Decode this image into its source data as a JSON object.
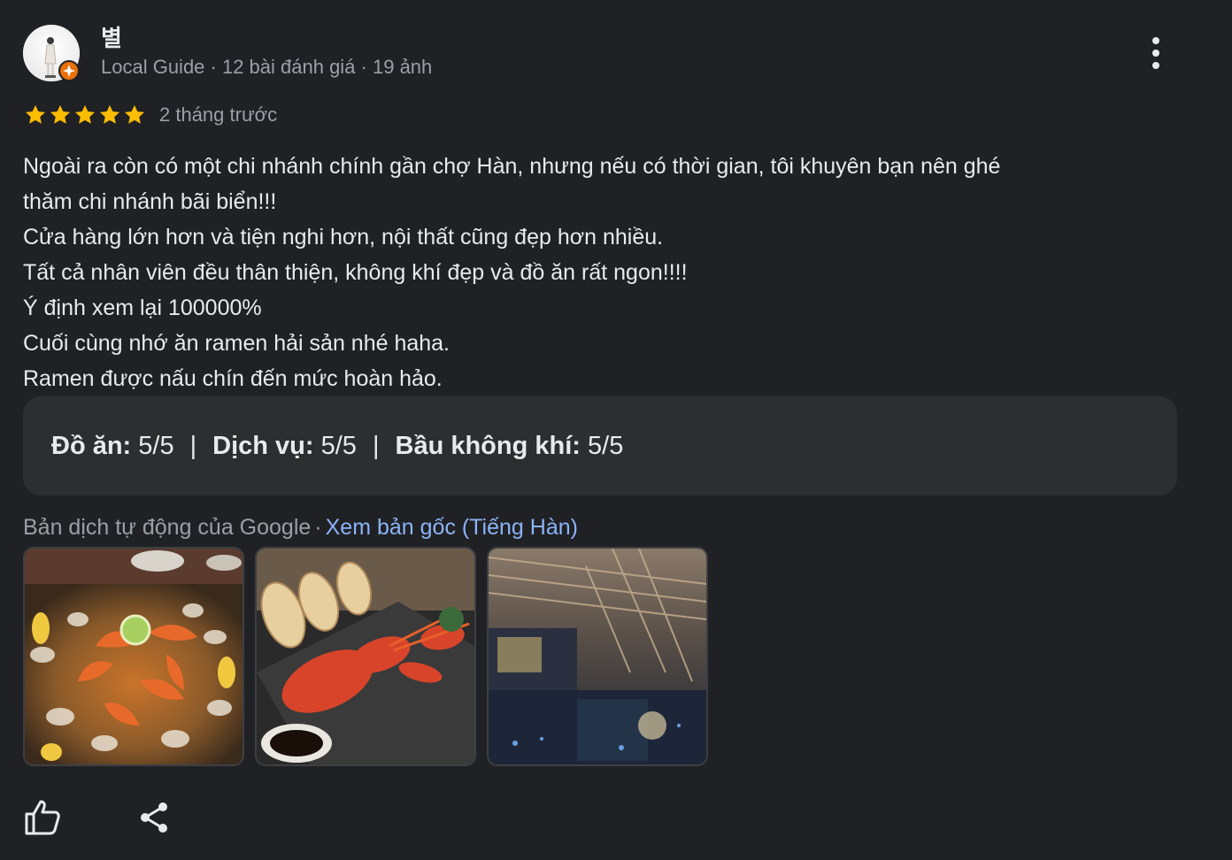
{
  "reviewer": {
    "name": "별",
    "meta": "Local Guide · 12 bài đánh giá · 19 ảnh"
  },
  "review": {
    "stars": 5,
    "time": "2 tháng trước",
    "lines": [
      "Ngoài ra còn có một chi nhánh chính gần chợ Hàn, nhưng nếu có thời gian, tôi khuyên bạn nên ghé",
      "thăm chi nhánh bãi biển!!!",
      "Cửa hàng lớn hơn và tiện nghi hơn, nội thất cũng đẹp hơn nhiều.",
      "Tất cả nhân viên đều thân thiện, không khí đẹp và đồ ăn rất ngon!!!!",
      "Ý định xem lại 100000%",
      "Cuối cùng nhớ ăn ramen hải sản nhé haha.",
      "Ramen được nấu chín đến mức hoàn hảo."
    ]
  },
  "ratings": [
    {
      "label": "Đồ ăn:",
      "value": "5/5"
    },
    {
      "label": "Dịch vụ:",
      "value": "5/5"
    },
    {
      "label": "Bầu không khí:",
      "value": "5/5"
    }
  ],
  "ratings_separator": "|",
  "translation": {
    "label": "Bản dịch tự động của Google",
    "dot": "·",
    "link": "Xem bản gốc (Tiếng Hàn)"
  },
  "photos": [
    {
      "subject": "seafood-platter"
    },
    {
      "subject": "lobster-and-bread"
    },
    {
      "subject": "restaurant-interior"
    }
  ],
  "colors": {
    "background": "#202124",
    "star": "#fbbc04",
    "link": "#8ab4f8",
    "secondary_text": "#9aa0a6",
    "badge": "#e8710a"
  },
  "icons": {
    "more": "more-vert-icon",
    "like": "thumb-up-icon",
    "share": "share-icon",
    "star": "star-icon",
    "badge": "local-guide-badge-icon"
  }
}
